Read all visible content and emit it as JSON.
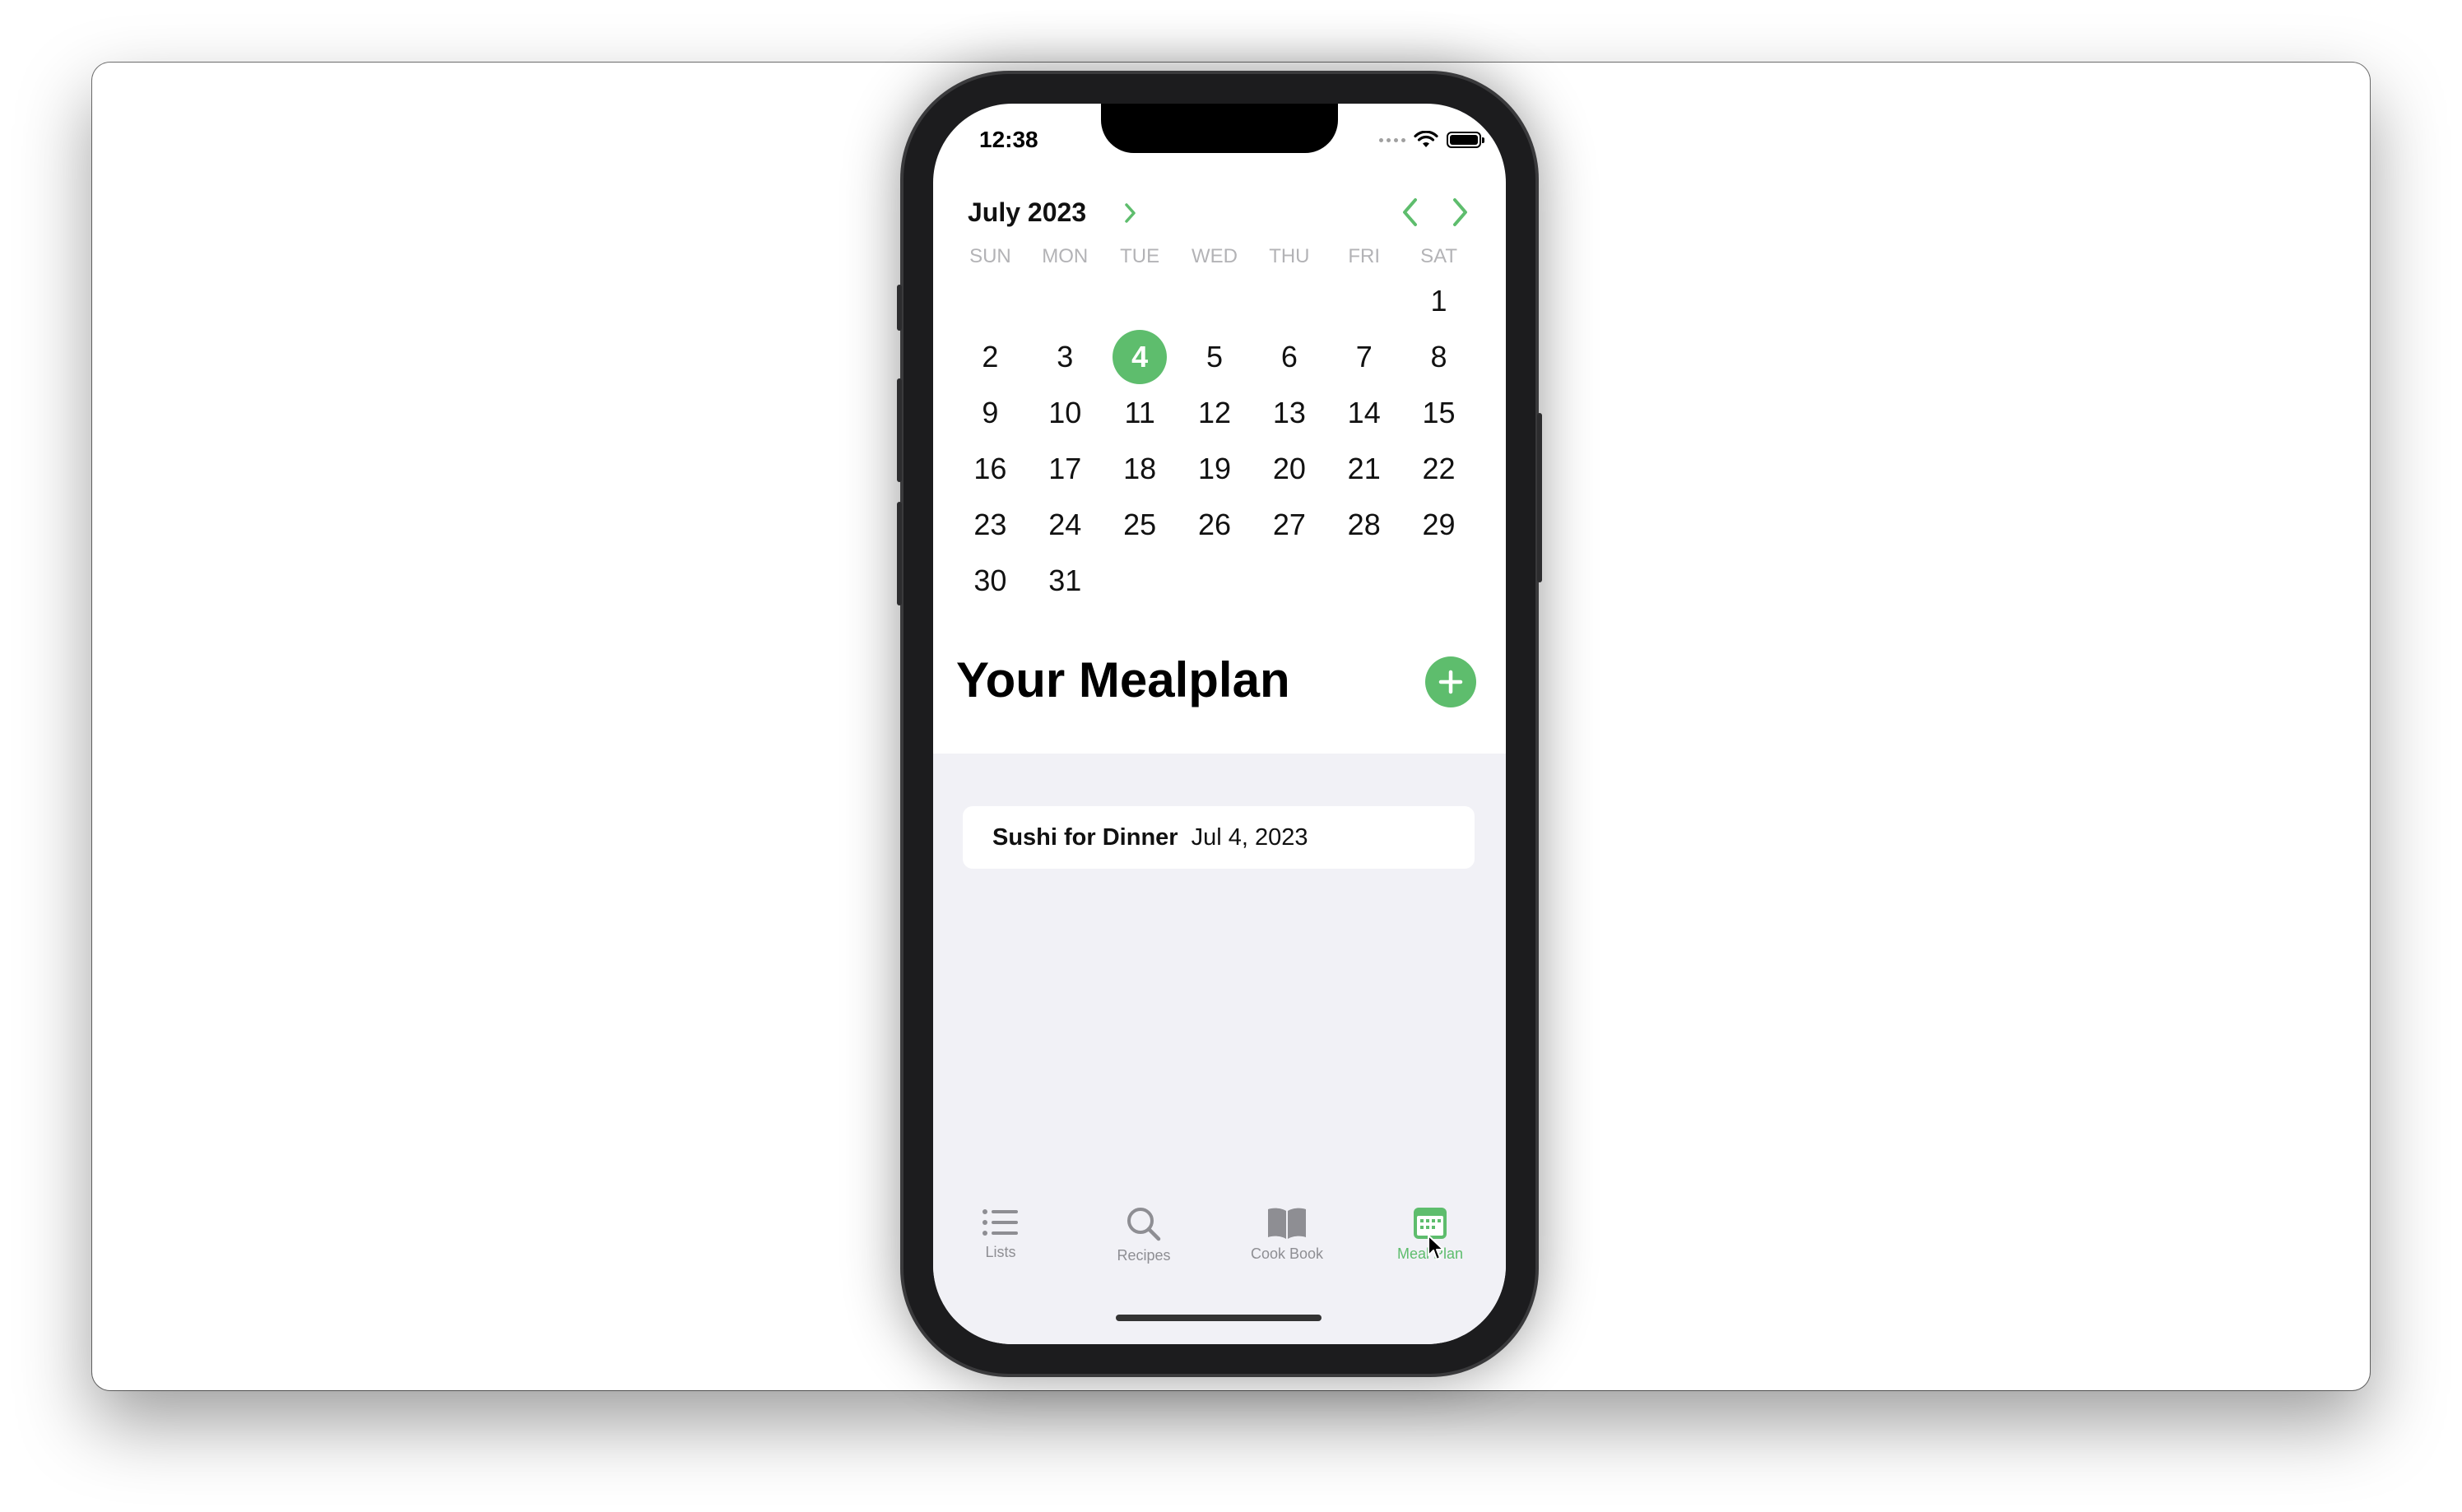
{
  "status_bar": {
    "time": "12:38"
  },
  "calendar": {
    "month_label": "July 2023",
    "weekdays": [
      "SUN",
      "MON",
      "TUE",
      "WED",
      "THU",
      "FRI",
      "SAT"
    ],
    "selected_day": "4",
    "days": [
      "",
      "",
      "",
      "",
      "",
      "",
      "1",
      "2",
      "3",
      "4",
      "5",
      "6",
      "7",
      "8",
      "9",
      "10",
      "11",
      "12",
      "13",
      "14",
      "15",
      "16",
      "17",
      "18",
      "19",
      "20",
      "21",
      "22",
      "23",
      "24",
      "25",
      "26",
      "27",
      "28",
      "29",
      "30",
      "31",
      "",
      "",
      "",
      "",
      ""
    ]
  },
  "mealplan": {
    "title": "Your Mealplan",
    "items": [
      {
        "name": "Sushi for Dinner",
        "date": "Jul 4, 2023"
      }
    ]
  },
  "tabs": [
    {
      "label": "Lists",
      "icon": "list-icon"
    },
    {
      "label": "Recipes",
      "icon": "search-icon"
    },
    {
      "label": "Cook Book",
      "icon": "book-icon"
    },
    {
      "label": "Meal Plan",
      "icon": "calendar-icon",
      "active": true
    }
  ],
  "colors": {
    "accent": "#5ebd6d",
    "list_background": "#f1f1f6"
  }
}
